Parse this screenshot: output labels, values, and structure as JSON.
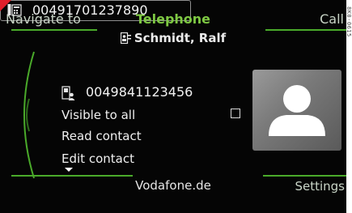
{
  "header": {
    "left_tab": "Navigate to",
    "title": "Telephone",
    "right_tab": "Call"
  },
  "contact": {
    "name": "Schmidt, Ralf",
    "icon": "contact-card-icon"
  },
  "entries": {
    "phone1": {
      "number": "00491701237890",
      "icon": "phone-landline-icon"
    },
    "phone2": {
      "number": "0049841123456",
      "icon": "phone-mobile-icon"
    }
  },
  "options": {
    "visible_to_all": "Visible to all",
    "visible_checked": false,
    "read_contact": "Read contact",
    "edit_contact": "Edit contact"
  },
  "footer": {
    "provider": "Vodafone.de",
    "settings": "Settings"
  },
  "corner_code": "8K0-0615",
  "colors": {
    "accent_green": "#7ec843",
    "line_green": "#4aaa2a",
    "background": "#050505",
    "text": "#f0f0f0"
  }
}
